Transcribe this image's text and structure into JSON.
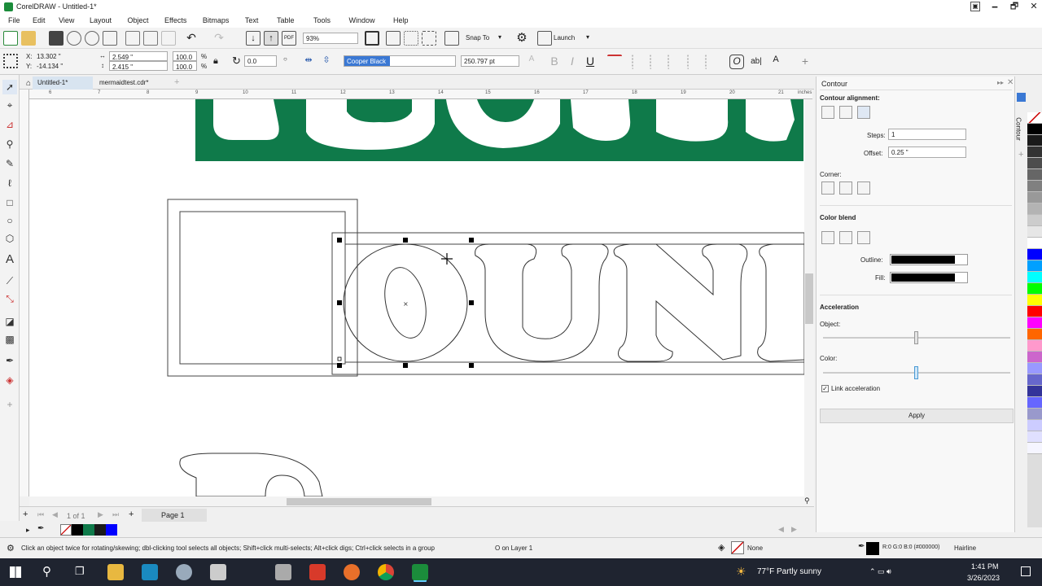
{
  "app": {
    "title": "CorelDRAW - Untitled-1*",
    "window_min": "🗕",
    "window_max": "🗗",
    "window_close": "✕"
  },
  "menu": [
    "File",
    "Edit",
    "View",
    "Layout",
    "Object",
    "Effects",
    "Bitmaps",
    "Text",
    "Table",
    "Tools",
    "Window",
    "Help"
  ],
  "toolbar": {
    "zoom": "93%",
    "snap_to": "Snap To",
    "launch": "Launch"
  },
  "property_bar": {
    "x": "13.302 \"",
    "y": "-14.134 \"",
    "w": "2.549 \"",
    "h": "2.415 \"",
    "scale_w": "100.0",
    "scale_h": "100.0",
    "percent": "%",
    "angle": "0.0",
    "font": "Cooper Black",
    "font_size": "250.797 pt",
    "bold": "B",
    "italic": "I",
    "underline": "U",
    "abc": "ab|",
    "plus": "+"
  },
  "tabs": {
    "doc1": "Untitled-1*",
    "doc2": "mermaidtest.cdr*",
    "add": "+"
  },
  "ruler": {
    "ticks": [
      "6",
      "7",
      "8",
      "9",
      "10",
      "11",
      "12",
      "13",
      "14",
      "15",
      "16",
      "17",
      "18",
      "19",
      "20",
      "21"
    ],
    "unit": "inches"
  },
  "page_nav": {
    "count": "1 of 1",
    "page_label": "Page 1"
  },
  "docker": {
    "title": "Contour",
    "side_tab": "Contour",
    "alignment_label": "Contour alignment:",
    "steps_label": "Steps:",
    "steps_value": "1",
    "offset_label": "Offset:",
    "offset_value": "0.25 \"",
    "corner_label": "Corner:",
    "color_blend_label": "Color blend",
    "outline_label": "Outline:",
    "fill_label": "Fill:",
    "acceleration_label": "Acceleration",
    "object_label": "Object:",
    "color_label": "Color:",
    "link_label": "Link acceleration",
    "apply_label": "Apply",
    "outline_color": "#000000",
    "fill_color": "#000000"
  },
  "status": {
    "hint": "Click an object twice for rotating/skewing; dbl-clicking tool selects all objects; Shift+click multi-selects; Alt+click digs; Ctrl+click selects in a group",
    "layer": "O on Layer 1",
    "fill": "None",
    "outline_info": "R:0 G:0 B:0 (#000000)",
    "outline_width": "Hairline"
  },
  "taskbar": {
    "weather": "77°F  Partly sunny",
    "time": "1:41 PM",
    "date": "3/26/2023"
  },
  "colors": {
    "green": "#0f7a4a",
    "palette": [
      "#ffffff",
      "#000000",
      "#1a1a1a",
      "#333333",
      "#4d4d4d",
      "#666666",
      "#808080",
      "#999999",
      "#b3b3b3",
      "#cccccc",
      "#e6e6e6",
      "#ffffff",
      "#0000ff",
      "#00a0ff",
      "#00ffff",
      "#00ff00",
      "#ffff00",
      "#ff0000",
      "#ff00ff",
      "#ff6600",
      "#ff99cc",
      "#cc66cc",
      "#9999ff",
      "#6666cc",
      "#333399",
      "#6666ff",
      "#9999cc",
      "#ccccff",
      "#e0e0ff",
      "#f5f5ff"
    ],
    "doc_palette": [
      "#000000",
      "#0f7a4a",
      "#1a1a1a",
      "#0000ff"
    ]
  }
}
